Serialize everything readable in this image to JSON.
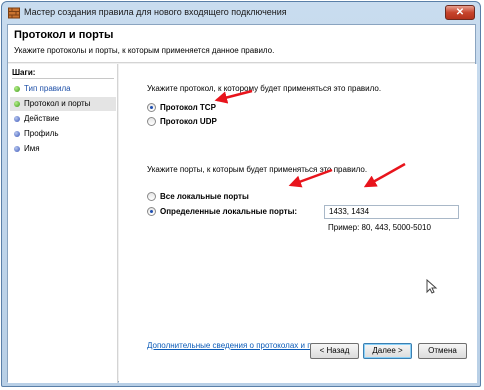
{
  "window": {
    "title": "Мастер создания правила для нового входящего подключения",
    "close_label": "✕"
  },
  "header": {
    "title": "Протокол и порты",
    "subtitle": "Укажите протоколы и порты, к которым применяется данное правило."
  },
  "steps": {
    "label": "Шаги:",
    "items": [
      {
        "label": "Тип правила",
        "state": "done"
      },
      {
        "label": "Протокол и порты",
        "state": "current"
      },
      {
        "label": "Действие",
        "state": "pending"
      },
      {
        "label": "Профиль",
        "state": "pending"
      },
      {
        "label": "Имя",
        "state": "pending"
      }
    ]
  },
  "protocol": {
    "prompt": "Укажите протокол, к которому будет применяться это правило.",
    "options": [
      {
        "label": "Протокол TCP",
        "checked": true
      },
      {
        "label": "Протокол UDP",
        "checked": false
      }
    ]
  },
  "ports": {
    "prompt": "Укажите порты, к которым будет применяться это правило.",
    "options": [
      {
        "label": "Все локальные порты",
        "checked": false
      },
      {
        "label": "Определенные локальные порты:",
        "checked": true
      }
    ],
    "value": "1433, 1434",
    "example": "Пример: 80, 443, 5000-5010"
  },
  "link": "Дополнительные сведения о протоколах и портах",
  "buttons": {
    "back": "< Назад",
    "next": "Далее >",
    "cancel": "Отмена"
  },
  "colors": {
    "link": "#0b5bb8",
    "arrow": "#e8141c",
    "done_dot": "#3e9a18",
    "pending_dot": "#3a56b8"
  }
}
